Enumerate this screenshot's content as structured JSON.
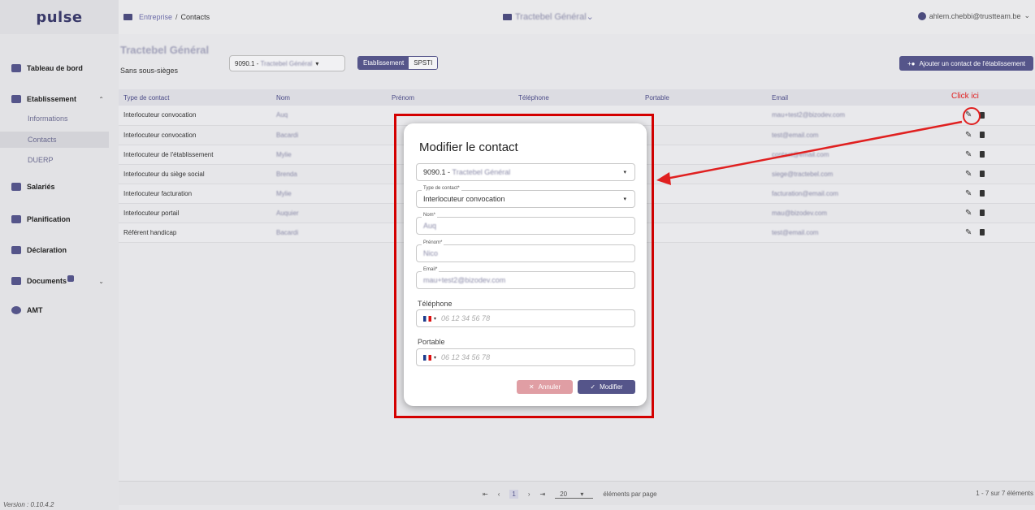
{
  "header": {
    "logo": "pulse",
    "breadcrumb_link": "Entreprise",
    "breadcrumb_sep": "/",
    "breadcrumb_current": "Contacts",
    "company": "Tractebel Général",
    "user_email": "ahlem.chebbi@trustteam.be"
  },
  "sidebar": {
    "dashboard": "Tableau de bord",
    "establishment": "Etablissement",
    "sub_informations": "Informations",
    "sub_contacts": "Contacts",
    "sub_duerp": "DUERP",
    "salaries": "Salariés",
    "planification": "Planification",
    "declaration": "Déclaration",
    "documents": "Documents",
    "amt": "AMT",
    "version": "Version : 0.10.4.2"
  },
  "main": {
    "title": "Tractebel Général",
    "subtitle": "Sans sous-sièges",
    "select_code": "9090.1 -",
    "select_name": "Tractebel Général",
    "seg_left": "Etablissement",
    "seg_right": "SPSTI",
    "add_button": "Ajouter un contact de l'établissement",
    "columns": [
      "Type de contact",
      "Nom",
      "Prénom",
      "Téléphone",
      "Portable",
      "Email"
    ],
    "rows": [
      {
        "type": "Interlocuteur convocation",
        "nom": "Auq",
        "email": "mau+test2@bizodev.com"
      },
      {
        "type": "Interlocuteur convocation",
        "nom": "Bacardi",
        "email": "test@email.com"
      },
      {
        "type": "Interlocuteur de l'établissement",
        "nom": "Mylie",
        "email": "contact@email.com"
      },
      {
        "type": "Interlocuteur du siège social",
        "nom": "Brenda",
        "email": "siege@tractebel.com"
      },
      {
        "type": "Interlocuteur facturation",
        "nom": "Mylie",
        "email": "facturation@email.com"
      },
      {
        "type": "Interlocuteur portail",
        "nom": "Auquier",
        "email": "mau@bizodev.com"
      },
      {
        "type": "Référent handicap",
        "nom": "Bacardi",
        "email": "test@email.com"
      }
    ],
    "pager_page": "1",
    "rows_per_page": "20",
    "rows_label": "éléments par page",
    "count": "1 - 7 sur 7 éléments"
  },
  "modal": {
    "title": "Modifier le contact",
    "est_code": "9090.1 -",
    "est_name": "Tractebel Général",
    "type_label": "Type de contact*",
    "type_value": "Interlocuteur convocation",
    "nom_label": "Nom*",
    "nom_value": "Auq",
    "prenom_label": "Prénom*",
    "prenom_value": "Nico",
    "email_label": "Email*",
    "email_value": "mau+test2@bizodev.com",
    "tel_label": "Téléphone",
    "tel_placeholder": "06 12 34 56 78",
    "port_label": "Portable",
    "port_placeholder": "06 12 34 56 78",
    "cancel": "Annuler",
    "submit": "Modifier"
  },
  "annotation": {
    "click_label": "Click  ici"
  },
  "colors": {
    "accent": "#55558a",
    "annotation_red": "#e02020",
    "cancel": "#e09ea4"
  }
}
